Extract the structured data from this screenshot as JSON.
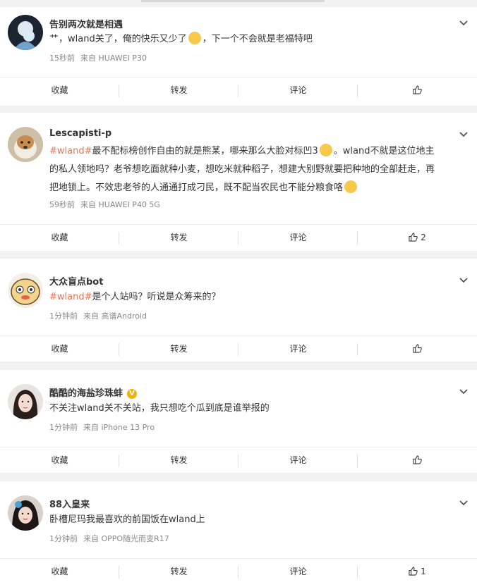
{
  "posts": [
    {
      "username": "告别两次就是相遇",
      "content_pre": "艹，wland关了，俺的快乐又少了",
      "content_post": "，下一个不会就是老福特吧",
      "time": "15秒前",
      "source": "来自 HUAWEI P30",
      "actions": {
        "collect": "收藏",
        "repost": "转发",
        "comment": "评论",
        "like_count": ""
      }
    },
    {
      "username": "Lescapisti-p",
      "topic": "#wland#",
      "content_line1_rest": "最不配标榜创作自由的就是熊某，哪来那么大脸对标凹3",
      "content_line1_after": "。wland不就是这位地主",
      "content_line2": "的私人领地吗？老爷想吃面就种小麦，想吃米就种稻子，想建大别野就要把种地的全部赶走，再",
      "content_line3": "把地锁上。不效忠老爷的人通通打成刁民，既不配当农民也不能分粮食咯",
      "time": "59秒前",
      "source": "来自 HUAWEI P40 5G",
      "actions": {
        "collect": "收藏",
        "repost": "转发",
        "comment": "评论",
        "like_count": "2"
      }
    },
    {
      "username": "大众盲点bot",
      "topic": "#wland#",
      "content_rest": "是个人站吗？听说是众筹来的？",
      "time": "1分钟前",
      "source": "来自 高谱Android",
      "actions": {
        "collect": "收藏",
        "repost": "转发",
        "comment": "评论",
        "like_count": ""
      }
    },
    {
      "username": "酷酷的海盐珍珠蚌",
      "content": "不关注wland关不关站，我只想吃个瓜到底是谁举报的",
      "time": "1分钟前",
      "source": "来自 iPhone 13 Pro",
      "actions": {
        "collect": "收藏",
        "repost": "转发",
        "comment": "评论",
        "like_count": ""
      }
    },
    {
      "username": "88入皇来",
      "content": "卧槽尼玛我最喜欢的前国饭在wland上",
      "time": "1分钟前",
      "source": "来自 OPPO随光而变R17",
      "actions": {
        "collect": "收藏",
        "repost": "转发",
        "comment": "评论",
        "like_count": "1"
      }
    }
  ],
  "colors": {
    "topic": "#eb7350",
    "badge": "#f0b400",
    "meta": "#888888"
  }
}
